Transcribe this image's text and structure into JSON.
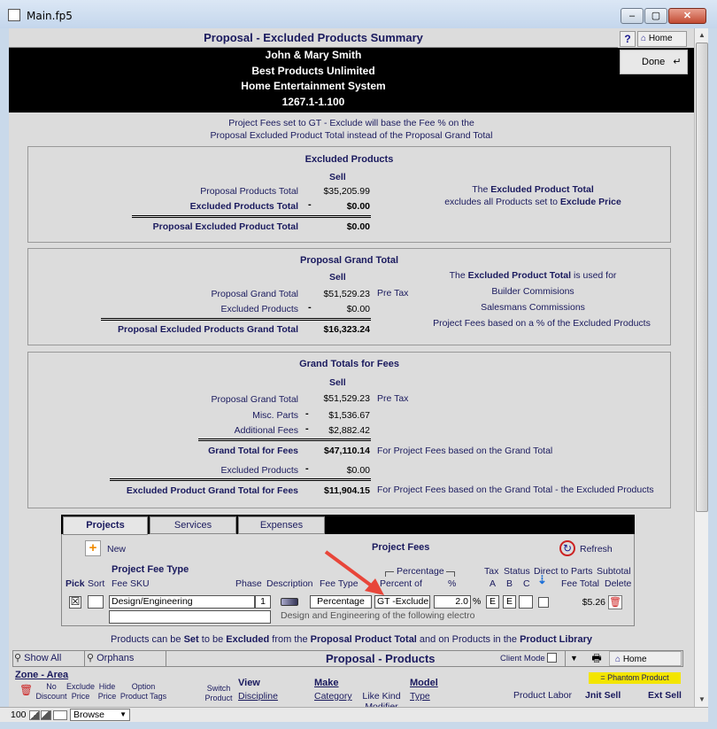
{
  "window": {
    "title": "Main.fp5",
    "min": "–",
    "max": "▢",
    "close": "✕"
  },
  "header": {
    "page_title": "Proposal - Excluded Products Summary",
    "help": "?",
    "home": "Home",
    "done": "Done",
    "client_lines": [
      "John & Mary Smith",
      "Best Products Unlimited",
      "Home Entertainment System",
      "1267.1-1.100"
    ]
  },
  "note": {
    "line1": "Project Fees set to GT - Exclude will base the Fee % on the",
    "line2": "Proposal Excluded Product Total instead of the Proposal Grand Total"
  },
  "excluded_products": {
    "title": "Excluded Products",
    "sell": "Sell",
    "rows": [
      {
        "label": "Proposal Products Total",
        "op": "",
        "value": "$35,205.99"
      },
      {
        "label": "Excluded Products Total",
        "op": "-",
        "value": "$0.00"
      },
      {
        "label": "Proposal Excluded Product Total",
        "op": "",
        "value": "$0.00"
      }
    ],
    "side_a": "The ",
    "side_b": "Excluded Product Total",
    "side_c": "excludes all Products set to ",
    "side_d": "Exclude Price"
  },
  "grand_total": {
    "title": "Proposal Grand Total",
    "sell": "Sell",
    "rows": [
      {
        "label": "Proposal Grand Total",
        "op": "",
        "value": "$51,529.23",
        "note": "Pre Tax"
      },
      {
        "label": "Excluded Products",
        "op": "-",
        "value": "$0.00"
      },
      {
        "label": "Proposal Excluded Products Grand Total",
        "op": "",
        "value": "$16,323.24"
      }
    ],
    "side_a": "The ",
    "side_b": "Excluded Product Total",
    "side_c": " is used for",
    "side_lines": [
      "Builder Commisions",
      "Salesmans Commissions",
      "Project Fees based on a % of the Excluded Products"
    ]
  },
  "fees_totals": {
    "title": "Grand Totals for Fees",
    "sell": "Sell",
    "rows": [
      {
        "label": "Proposal Grand Total",
        "op": "",
        "value": "$51,529.23",
        "note": "Pre Tax"
      },
      {
        "label": "Misc. Parts",
        "op": "-",
        "value": "$1,536.67"
      },
      {
        "label": "Additional Fees",
        "op": "-",
        "value": "$2,882.42"
      },
      {
        "label": "Grand Total for Fees",
        "op": "",
        "value": "$47,110.14",
        "note": "For Project Fees based on the Grand Total"
      },
      {
        "label": "Excluded Products",
        "op": "-",
        "value": "$0.00"
      },
      {
        "label": "Excluded Product Grand Total for Fees",
        "op": "",
        "value": "$11,904.15",
        "note": "For Project Fees based on the Grand Total - the Excluded Products"
      }
    ]
  },
  "tabs": {
    "items": [
      "Projects",
      "Services",
      "Expenses"
    ],
    "new": "New",
    "section_title": "Project Fees",
    "refresh": "Refresh",
    "col_fee_type": "Project Fee Type",
    "col_pick": "Pick",
    "col_sort": "Sort",
    "col_fee_sku": "Fee SKU",
    "col_phase": "Phase",
    "col_description": "Description",
    "col_fee_type2": "Fee Type",
    "col_percentage": "Percentage",
    "col_percent_of": "Percent of",
    "col_pct": "%",
    "col_tax": "Tax",
    "col_status": "Status",
    "col_direct": "Direct to Parts",
    "col_subtotal": "Subtotal",
    "col_a": "A",
    "col_b": "B",
    "col_c": "C",
    "col_fee_total": "Fee Total",
    "col_delete": "Delete",
    "row": {
      "pick": "☒",
      "name": "Design/Engineering",
      "phase": "1",
      "fee_type": "Percentage",
      "percent_of": "GT -Exclude",
      "pct_value": "2.0",
      "pct_sign": "%",
      "a": "E",
      "b": "E",
      "fee_total": "$5.26",
      "description": "Design and Engineering of  the following electro"
    }
  },
  "products_note": {
    "a": "Products can be ",
    "b": "Set",
    "c": " to be ",
    "d": "Excluded",
    "e": " from the ",
    "f": "Proposal Product Total",
    "g": " and on Products in the ",
    "h": "Product Library"
  },
  "bottom": {
    "show_all": "Show All",
    "orphans": "Orphans",
    "title": "Proposal - Products",
    "client_mode": "Client Mode",
    "home": "Home",
    "phantom": "= Phantom Product",
    "zone_area": "Zone - Area",
    "no_discount": [
      "No",
      "Discount"
    ],
    "exclude_price": [
      "Exclude",
      "Price"
    ],
    "hide_price": [
      "Hide",
      "Price"
    ],
    "option_tags": [
      "Option",
      "Product Tags"
    ],
    "switch_product": [
      "Switch",
      "Product"
    ],
    "view": "View",
    "discipline": "Discipline",
    "make": "Make",
    "category": "Category",
    "like_kind": [
      "Like Kind",
      "Modifier"
    ],
    "model": "Model",
    "type": "Type",
    "product_labor": "Product Labor",
    "unit_sell": "Jnit Sell",
    "ext_sell": "Ext Sell"
  },
  "status": {
    "zoom": "100",
    "mode": "Browse"
  },
  "colors": {
    "navy": "#1a1a5e",
    "accent_red": "#e8463a",
    "phantom_yellow": "#f3e500"
  }
}
